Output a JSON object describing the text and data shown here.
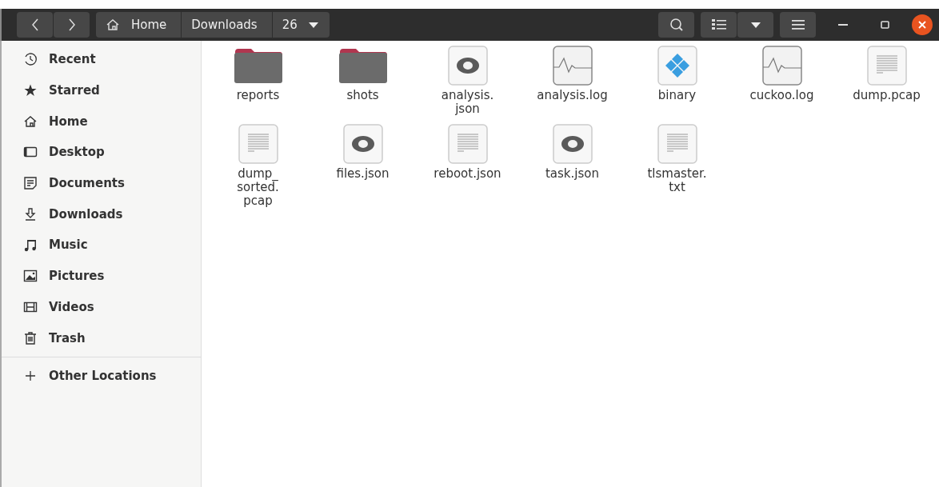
{
  "path_bar": [
    {
      "label": "Home",
      "kind": "home"
    },
    {
      "label": "Downloads",
      "kind": "plain"
    },
    {
      "label": "26",
      "kind": "current"
    }
  ],
  "sidebar": {
    "places": [
      {
        "label": "Recent",
        "kind": "recent"
      },
      {
        "label": "Starred",
        "kind": "star"
      },
      {
        "label": "Home",
        "kind": "home"
      },
      {
        "label": "Desktop",
        "kind": "desktop"
      },
      {
        "label": "Documents",
        "kind": "documents"
      },
      {
        "label": "Downloads",
        "kind": "downloads"
      },
      {
        "label": "Music",
        "kind": "music"
      },
      {
        "label": "Pictures",
        "kind": "pictures"
      },
      {
        "label": "Videos",
        "kind": "videos"
      },
      {
        "label": "Trash",
        "kind": "trash"
      }
    ],
    "other": {
      "label": "Other Locations"
    }
  },
  "files": [
    {
      "name": "reports",
      "kind": "folder"
    },
    {
      "name": "shots",
      "kind": "folder"
    },
    {
      "name": "analysis.\njson",
      "kind": "json"
    },
    {
      "name": "analysis.log",
      "kind": "log"
    },
    {
      "name": "binary",
      "kind": "binary"
    },
    {
      "name": "cuckoo.log",
      "kind": "log"
    },
    {
      "name": "dump.pcap",
      "kind": "text"
    },
    {
      "name": "dump_\nsorted.\npcap",
      "kind": "text"
    },
    {
      "name": "files.json",
      "kind": "json"
    },
    {
      "name": "reboot.json",
      "kind": "text"
    },
    {
      "name": "task.json",
      "kind": "json"
    },
    {
      "name": "tlsmaster.\ntxt",
      "kind": "text"
    }
  ]
}
